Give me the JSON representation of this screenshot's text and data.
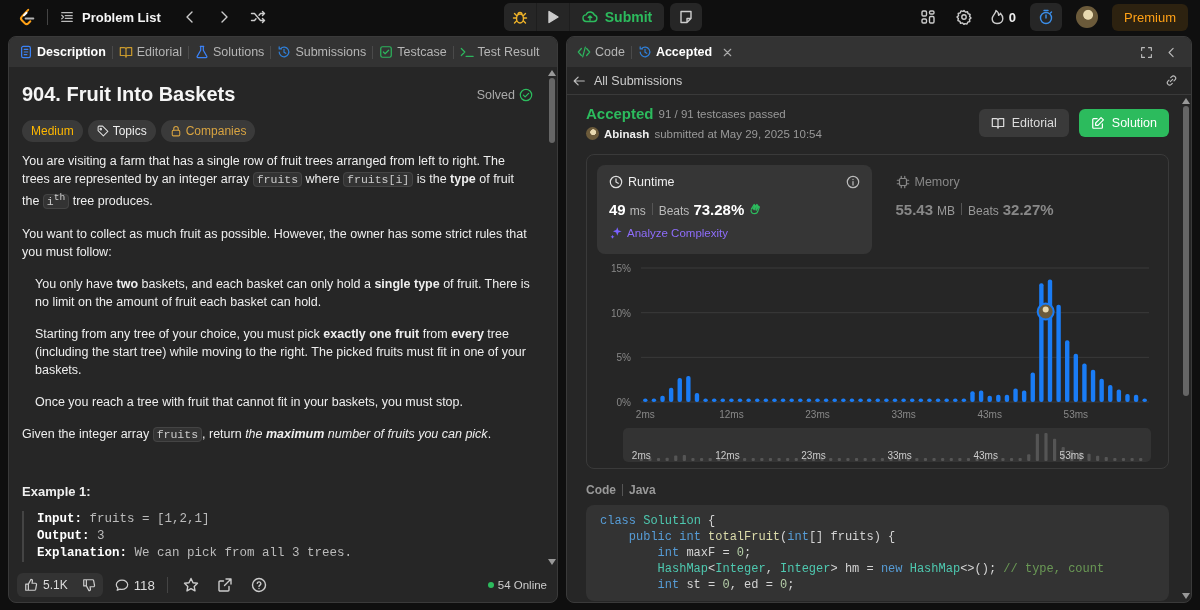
{
  "top_bar": {
    "title": "Problem List",
    "submit": "Submit",
    "streak": "0",
    "premium": "Premium"
  },
  "problem_panel": {
    "tabs": [
      {
        "label": "Description",
        "selected": true
      },
      {
        "label": "Editorial",
        "selected": false
      },
      {
        "label": "Solutions",
        "selected": false
      },
      {
        "label": "Submissions",
        "selected": false
      },
      {
        "label": "Testcase",
        "selected": false
      },
      {
        "label": "Test Result",
        "selected": false
      }
    ],
    "title": "904. Fruit Into Baskets",
    "status": "Solved",
    "tags": [
      {
        "label": "Medium",
        "kind": "difficulty"
      },
      {
        "label": "Topics",
        "kind": "topics"
      },
      {
        "label": "Companies",
        "kind": "companies"
      }
    ],
    "description": [
      {
        "kind": "paragraph",
        "parts": [
          {
            "kind": "text",
            "text": "You are visiting a farm that has a single row of fruit trees arranged from left to right. The trees are represented by an integer array "
          },
          {
            "kind": "code",
            "text": "fruits"
          },
          {
            "kind": "text",
            "text": " where "
          },
          {
            "kind": "code",
            "text": "fruits[i]"
          },
          {
            "kind": "text",
            "text": " is the **type** of fruit the "
          },
          {
            "kind": "code",
            "text": "i$^{th}$"
          },
          {
            "kind": "text",
            "text": " tree produces."
          }
        ]
      },
      {
        "kind": "paragraph",
        "parts": [
          {
            "kind": "text",
            "text": "You want to collect as much fruit as possible. However, the owner has some strict rules that you must follow:"
          }
        ]
      },
      {
        "kind": "bullet",
        "parts": [
          {
            "kind": "text",
            "text": "You only have **two** baskets, and each basket can only hold a **single type** of fruit. There is no limit on the amount of fruit each basket can hold."
          }
        ]
      },
      {
        "kind": "bullet",
        "parts": [
          {
            "kind": "text",
            "text": "Starting from any tree of your choice, you must pick **exactly one fruit** from **every** tree (including the start tree) while moving to the right. The picked fruits must fit in one of your baskets."
          }
        ]
      },
      {
        "kind": "bullet",
        "parts": [
          {
            "kind": "text",
            "text": "Once you reach a tree with fruit that cannot fit in your baskets, you must stop."
          }
        ]
      },
      {
        "kind": "paragraph",
        "parts": [
          {
            "kind": "text",
            "text": "Given the integer array "
          },
          {
            "kind": "code",
            "text": "fruits"
          },
          {
            "kind": "text",
            "text": ", return "
          },
          {
            "kind": "em",
            "text": "the **maximum** number of fruits you can pick"
          },
          {
            "kind": "text",
            "text": "."
          }
        ]
      }
    ],
    "example": {
      "title": "Example 1:",
      "lines": [
        {
          "label": "Input:",
          "value": "fruits = [1,2,1]"
        },
        {
          "label": "Output:",
          "value": "3"
        },
        {
          "label": "Explanation:",
          "value": "We can pick from all 3 trees."
        }
      ]
    },
    "footer": {
      "likes": "5.1K",
      "comments": "118",
      "online": "54 Online"
    }
  },
  "submission_panel": {
    "tabs": [
      {
        "label": "Code",
        "selected": false,
        "closable": false
      },
      {
        "label": "Accepted",
        "selected": true,
        "closable": true
      }
    ],
    "back_link": "All Submissions",
    "result": {
      "status": "Accepted",
      "testcases": "91 / 91 testcases passed",
      "user": "Abinash",
      "submitted": "submitted at May 29, 2025 10:54"
    },
    "actions": [
      {
        "label": "Editorial",
        "kind": "secondary"
      },
      {
        "label": "Solution",
        "kind": "primary"
      }
    ],
    "metrics": [
      {
        "title": "Runtime",
        "value": "49",
        "unit": "ms",
        "beats_label": "Beats",
        "beats": "73.28%",
        "selected": true,
        "analyze": "Analyze Complexity"
      },
      {
        "title": "Memory",
        "value": "55.43",
        "unit": "MB",
        "beats_label": "Beats",
        "beats": "32.27%",
        "selected": false
      }
    ],
    "chart_data": {
      "type": "bar",
      "ylim": [
        0,
        15
      ],
      "yticks": [
        {
          "value": 0,
          "label": "0%"
        },
        {
          "value": 5,
          "label": "5%"
        },
        {
          "value": 10,
          "label": "10%"
        },
        {
          "value": 15,
          "label": "15%"
        }
      ],
      "categories": [
        "2ms",
        null,
        null,
        null,
        null,
        null,
        null,
        null,
        null,
        null,
        "12ms",
        null,
        null,
        null,
        null,
        null,
        null,
        null,
        null,
        null,
        "23ms",
        null,
        null,
        null,
        null,
        null,
        null,
        null,
        null,
        null,
        "33ms",
        null,
        null,
        null,
        null,
        null,
        null,
        null,
        null,
        null,
        "43ms",
        null,
        null,
        null,
        null,
        null,
        null,
        null,
        null,
        null,
        "53ms",
        null,
        null,
        null,
        null,
        null,
        null,
        null,
        null
      ],
      "values": [
        0.4,
        0.4,
        0.7,
        1.6,
        2.7,
        2.9,
        1.0,
        0.4,
        0.4,
        0.4,
        0.4,
        0.4,
        0.4,
        0.4,
        0.4,
        0.4,
        0.4,
        0.4,
        0.4,
        0.4,
        0.4,
        0.4,
        0.4,
        0.4,
        0.4,
        0.4,
        0.4,
        0.4,
        0.4,
        0.4,
        0.4,
        0.4,
        0.4,
        0.4,
        0.4,
        0.4,
        0.4,
        0.4,
        1.2,
        1.3,
        0.7,
        0.8,
        0.8,
        1.5,
        1.3,
        3.3,
        13.3,
        13.7,
        10.9,
        6.9,
        5.4,
        4.3,
        3.6,
        2.6,
        1.9,
        1.4,
        0.9,
        0.8,
        0.4
      ]
    },
    "overview": {
      "labels": [
        "2ms",
        "12ms",
        "23ms",
        "33ms",
        "43ms",
        "53ms"
      ]
    },
    "code_header": {
      "title": "Code",
      "language": "Java"
    },
    "code": [
      "class Solution {",
      "    public int totalFruit(int[] fruits) {",
      "        int maxF = 0;",
      "        HashMap<Integer, Integer> hm = new HashMap<>(); // type, count",
      "        int st = 0, ed = 0;"
    ]
  }
}
